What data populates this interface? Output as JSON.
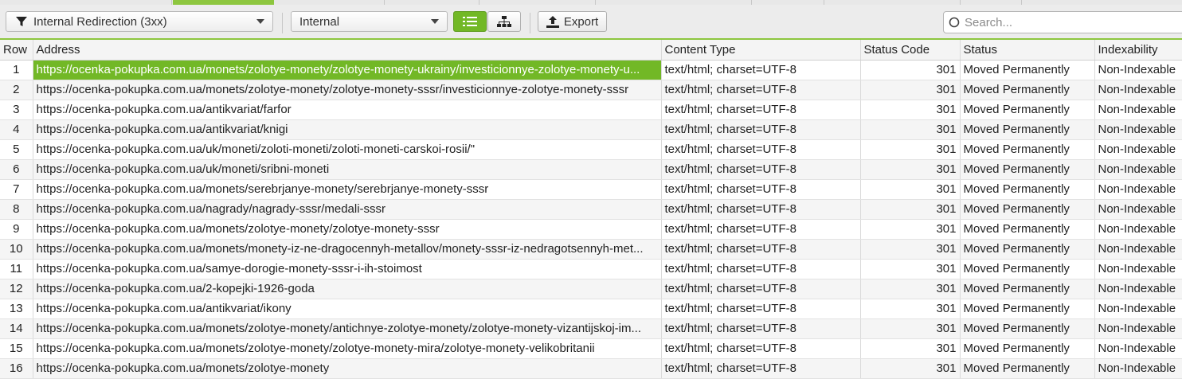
{
  "colors": {
    "accent": "#8dc63f",
    "selected_cell": "#72b826"
  },
  "toolbar": {
    "filter_label": "Internal Redirection (3xx)",
    "filter_icon": "funnel-icon",
    "type_label": "Internal",
    "list_view_icon": "list-view-icon",
    "tree_view_icon": "tree-view-icon",
    "export_label": "Export",
    "export_icon": "upload-icon",
    "search_placeholder": "Search..."
  },
  "table": {
    "headers": [
      "Row",
      "Address",
      "Content Type",
      "Status Code",
      "Status",
      "Indexability"
    ],
    "rows": [
      [
        "1",
        "https://ocenka-pokupka.com.ua/monets/zolotye-monety/zolotye-monety-ukrainy/investicionnye-zolotye-monety-u...",
        "text/html; charset=UTF-8",
        "301",
        "Moved Permanently",
        "Non-Indexable"
      ],
      [
        "2",
        "https://ocenka-pokupka.com.ua/monets/zolotye-monety/zolotye-monety-sssr/investicionnye-zolotye-monety-sssr",
        "text/html; charset=UTF-8",
        "301",
        "Moved Permanently",
        "Non-Indexable"
      ],
      [
        "3",
        "https://ocenka-pokupka.com.ua/antikvariat/farfor",
        "text/html; charset=UTF-8",
        "301",
        "Moved Permanently",
        "Non-Indexable"
      ],
      [
        "4",
        "https://ocenka-pokupka.com.ua/antikvariat/knigi",
        "text/html; charset=UTF-8",
        "301",
        "Moved Permanently",
        "Non-Indexable"
      ],
      [
        "5",
        "https://ocenka-pokupka.com.ua/uk/moneti/zoloti-moneti/zoloti-moneti-carskoi-rosii/\"",
        "text/html; charset=UTF-8",
        "301",
        "Moved Permanently",
        "Non-Indexable"
      ],
      [
        "6",
        "https://ocenka-pokupka.com.ua/uk/moneti/sribni-moneti",
        "text/html; charset=UTF-8",
        "301",
        "Moved Permanently",
        "Non-Indexable"
      ],
      [
        "7",
        "https://ocenka-pokupka.com.ua/monets/serebrjanye-monety/serebrjanye-monety-sssr",
        "text/html; charset=UTF-8",
        "301",
        "Moved Permanently",
        "Non-Indexable"
      ],
      [
        "8",
        "https://ocenka-pokupka.com.ua/nagrady/nagrady-sssr/medali-sssr",
        "text/html; charset=UTF-8",
        "301",
        "Moved Permanently",
        "Non-Indexable"
      ],
      [
        "9",
        "https://ocenka-pokupka.com.ua/monets/zolotye-monety/zolotye-monety-sssr",
        "text/html; charset=UTF-8",
        "301",
        "Moved Permanently",
        "Non-Indexable"
      ],
      [
        "10",
        "https://ocenka-pokupka.com.ua/monets/monety-iz-ne-dragocennyh-metallov/monety-sssr-iz-nedragotsennyh-met...",
        "text/html; charset=UTF-8",
        "301",
        "Moved Permanently",
        "Non-Indexable"
      ],
      [
        "11",
        "https://ocenka-pokupka.com.ua/samye-dorogie-monety-sssr-i-ih-stoimost",
        "text/html; charset=UTF-8",
        "301",
        "Moved Permanently",
        "Non-Indexable"
      ],
      [
        "12",
        "https://ocenka-pokupka.com.ua/2-kopejki-1926-goda",
        "text/html; charset=UTF-8",
        "301",
        "Moved Permanently",
        "Non-Indexable"
      ],
      [
        "13",
        "https://ocenka-pokupka.com.ua/antikvariat/ikony",
        "text/html; charset=UTF-8",
        "301",
        "Moved Permanently",
        "Non-Indexable"
      ],
      [
        "14",
        "https://ocenka-pokupka.com.ua/monets/zolotye-monety/antichnye-zolotye-monety/zolotye-monety-vizantijskoj-im...",
        "text/html; charset=UTF-8",
        "301",
        "Moved Permanently",
        "Non-Indexable"
      ],
      [
        "15",
        "https://ocenka-pokupka.com.ua/monets/zolotye-monety/zolotye-monety-mira/zolotye-monety-velikobritanii",
        "text/html; charset=UTF-8",
        "301",
        "Moved Permanently",
        "Non-Indexable"
      ],
      [
        "16",
        "https://ocenka-pokupka.com.ua/monets/zolotye-monety",
        "text/html; charset=UTF-8",
        "301",
        "Moved Permanently",
        "Non-Indexable"
      ]
    ]
  }
}
